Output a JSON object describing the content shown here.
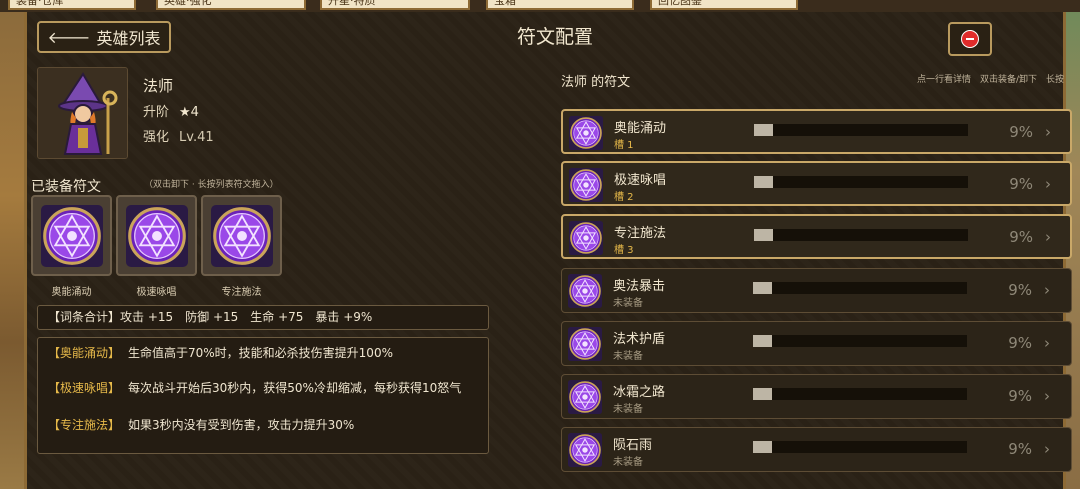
{
  "top_tabs": [
    "装备·仓库",
    "英雄·强化",
    "升星·特质",
    "宝箱",
    "回忆图鉴"
  ],
  "header": {
    "back_label": "英雄列表",
    "title": "符文配置"
  },
  "hero": {
    "name": "法师",
    "rank_label": "升阶",
    "rank_value": "★4",
    "enhance_label": "强化",
    "level": "Lv.41"
  },
  "equipped": {
    "title": "已装备符文",
    "hint": "（双击卸下 · 长按列表符文拖入）",
    "slots": [
      {
        "label": "奥能涌动"
      },
      {
        "label": "极速咏唱"
      },
      {
        "label": "专注施法"
      }
    ]
  },
  "summary": "【词条合计】攻击 +15　防御 +15　生命 +75　暴击 +9%",
  "descriptions": [
    {
      "tag": "【奥能涌动】",
      "text": "生命值高于70%时，技能和必杀技伤害提升100%"
    },
    {
      "tag": "【极速咏唱】",
      "text": "每次战斗开始后30秒内，获得50%冷却缩减，每秒获得10怒气"
    },
    {
      "tag": "【专注施法】",
      "text": "如果3秒内没有受到伤害，攻击力提升30%"
    }
  ],
  "rune_list": {
    "title": "法师 的符文",
    "hint": "点一行看详情　双击装备/卸下　长按",
    "items": [
      {
        "name": "奥能涌动",
        "status": "槽 1",
        "equipped": true,
        "progress": 0.09,
        "pct": "9%"
      },
      {
        "name": "极速咏唱",
        "status": "槽 2",
        "equipped": true,
        "progress": 0.09,
        "pct": "9%"
      },
      {
        "name": "专注施法",
        "status": "槽 3",
        "equipped": true,
        "progress": 0.09,
        "pct": "9%"
      },
      {
        "name": "奥法暴击",
        "status": "未装备",
        "equipped": false,
        "progress": 0.09,
        "pct": "9%"
      },
      {
        "name": "法术护盾",
        "status": "未装备",
        "equipped": false,
        "progress": 0.09,
        "pct": "9%"
      },
      {
        "name": "冰霜之路",
        "status": "未装备",
        "equipped": false,
        "progress": 0.09,
        "pct": "9%"
      },
      {
        "name": "陨石雨",
        "status": "未装备",
        "equipped": false,
        "progress": 0.09,
        "pct": "9%"
      }
    ]
  },
  "colors": {
    "panel": "#2b2216",
    "gold_border": "#b99a5e",
    "tag_gold": "#e6b94a",
    "rune_purple": "#8a3bd6",
    "close_red": "#e02b2b"
  }
}
